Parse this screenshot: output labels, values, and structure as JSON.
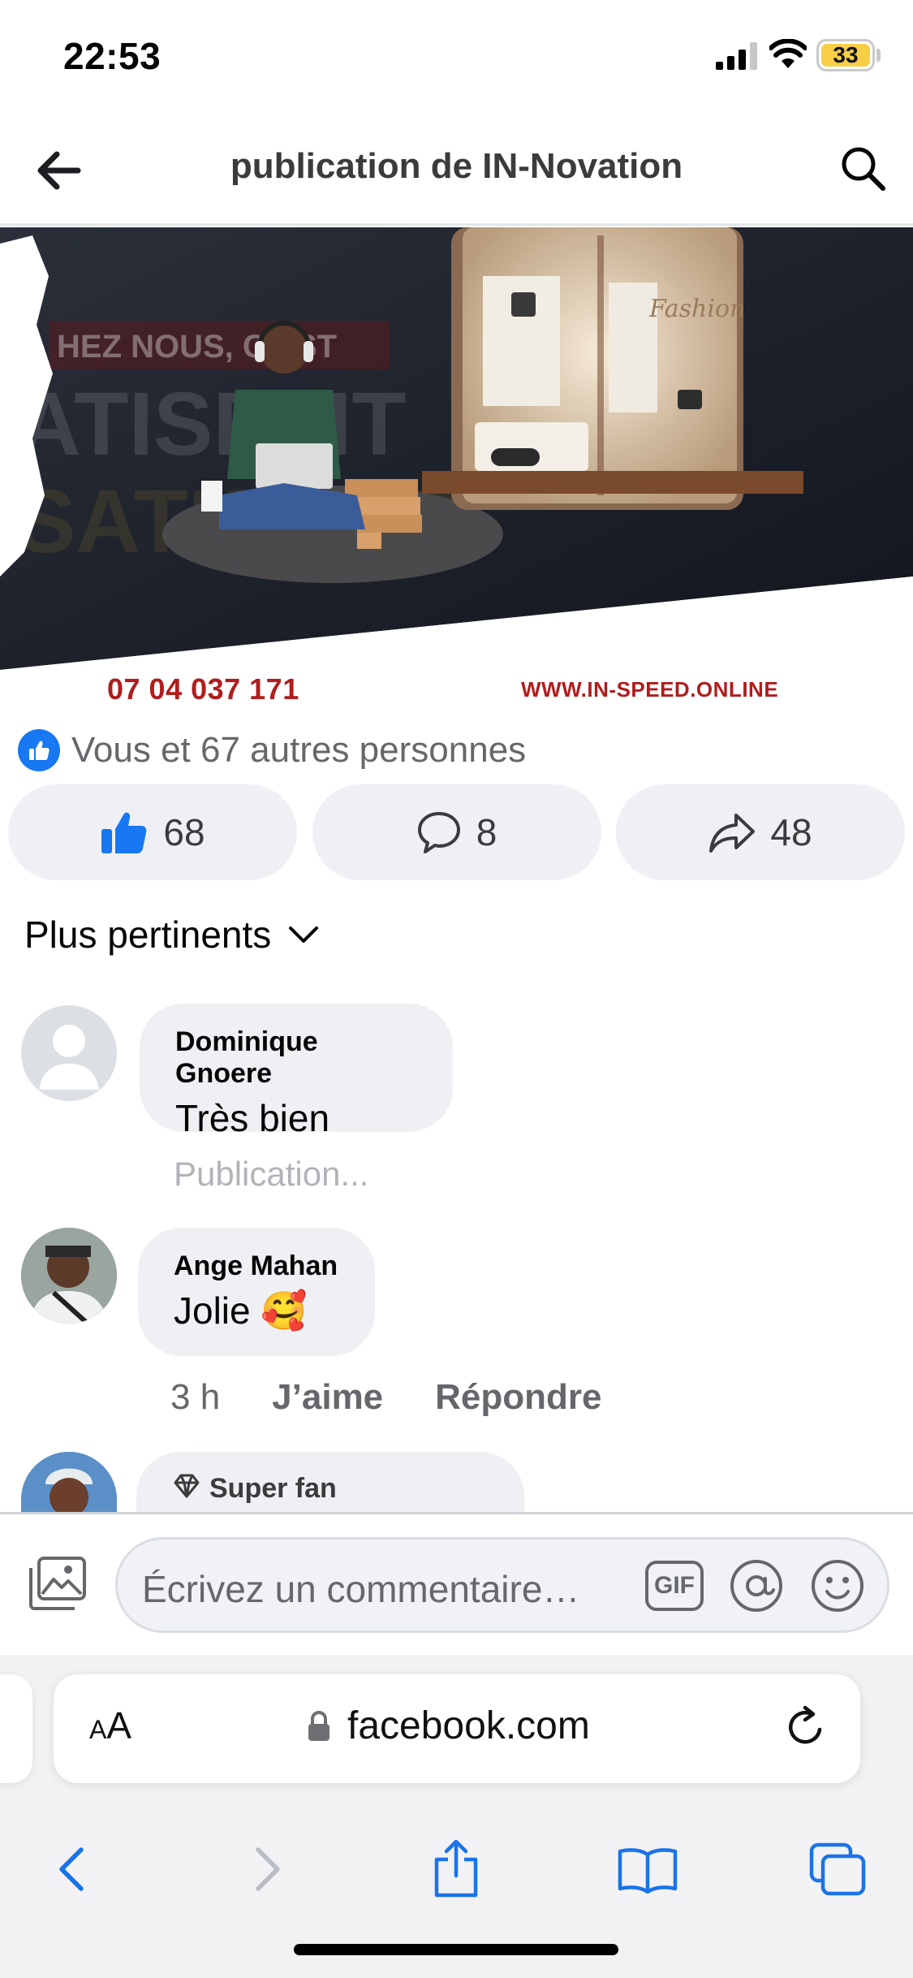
{
  "status_bar": {
    "time": "22:53",
    "battery": "33"
  },
  "header": {
    "title": "publication de IN-Novation"
  },
  "post_image": {
    "phone": "07 04 037 171",
    "website": "WWW.IN-SPEED.ONLINE"
  },
  "reactions": {
    "summary": "Vous et 67 autres personnes",
    "likes": "68",
    "comments": "8",
    "shares": "48"
  },
  "sort": {
    "label": "Plus pertinents"
  },
  "comments": [
    {
      "name": "Dominique Gnoere",
      "text": "Très bien",
      "status": "Publication..."
    },
    {
      "name": "Ange Mahan",
      "text": "Jolie 🥰",
      "time": "3 h",
      "like": "J’aime",
      "reply": "Répondre"
    },
    {
      "badge": "Super fan"
    }
  ],
  "composer": {
    "placeholder": "Écrivez un commentaire…",
    "gif": "GIF"
  },
  "safari": {
    "aa": "AA",
    "url": "facebook.com"
  },
  "colors": {
    "fb_blue": "#1877f2",
    "promo_red": "#b01d1d",
    "ios_blue": "#1a73e8",
    "bubble": "#eef0f3"
  }
}
